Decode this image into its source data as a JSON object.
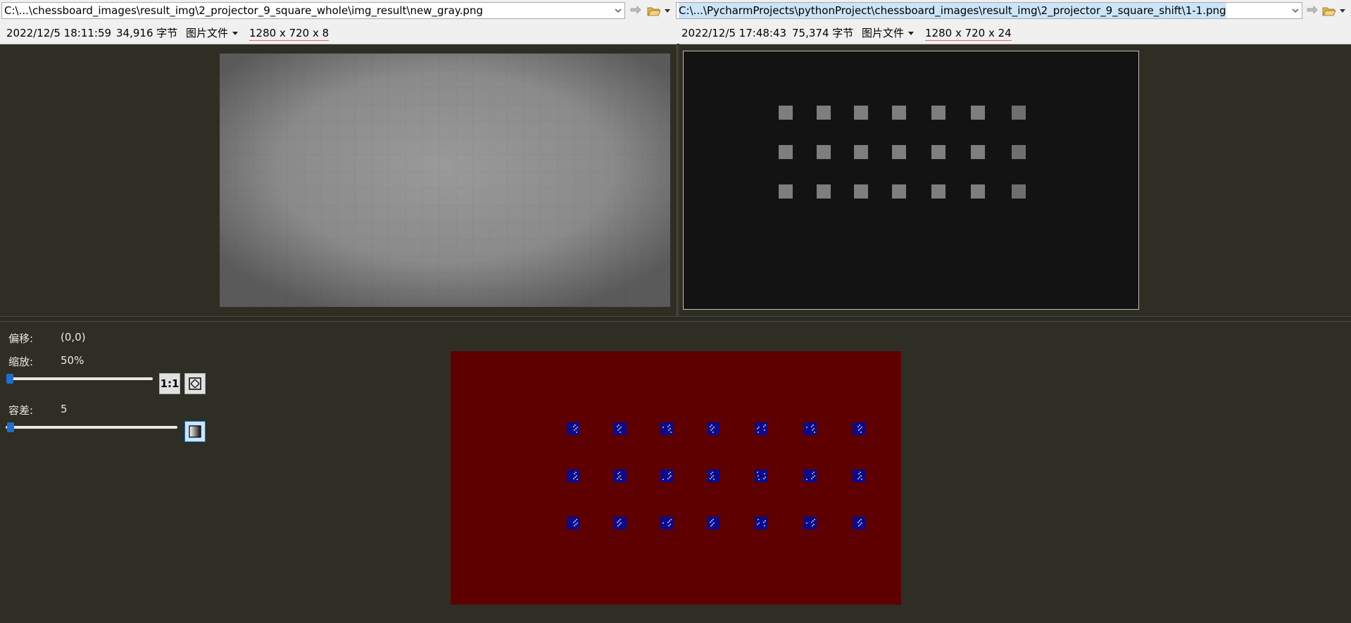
{
  "left": {
    "path": "C:\\...\\chessboard_images\\result_img\\2_projector_9_square_whole\\img_result\\new_gray.png",
    "date": "2022/12/5 18:11:59",
    "size": "34,916 字节",
    "type": "图片文件",
    "dims": "1280 x 720 x 8"
  },
  "right": {
    "path": "C:\\...\\PycharmProjects\\pythonProject\\chessboard_images\\result_img\\2_projector_9_square_shift\\1-1.png",
    "date": "2022/12/5 17:48:43",
    "size": "75,374 字节",
    "type": "图片文件",
    "dims": "1280 x 720 x 24"
  },
  "controls": {
    "offset_label": "偏移:",
    "offset_value": "(0,0)",
    "zoom_label": "缩放:",
    "zoom_value": "50%",
    "zoom_fraction": 0.02,
    "one_to_one": "1:1",
    "tolerance_label": "容差:",
    "tolerance_value": "5",
    "tolerance_fraction": 0.03
  },
  "icons": [
    "chevron-down-icon",
    "sync-arrow-icon",
    "folder-open-icon",
    "fit-to-window-icon",
    "gradient-toggle-icon"
  ],
  "colors": {
    "workspace": "#2e2e24",
    "diff_background": "#5e0000",
    "diff_marker": "#0a0a8c"
  }
}
